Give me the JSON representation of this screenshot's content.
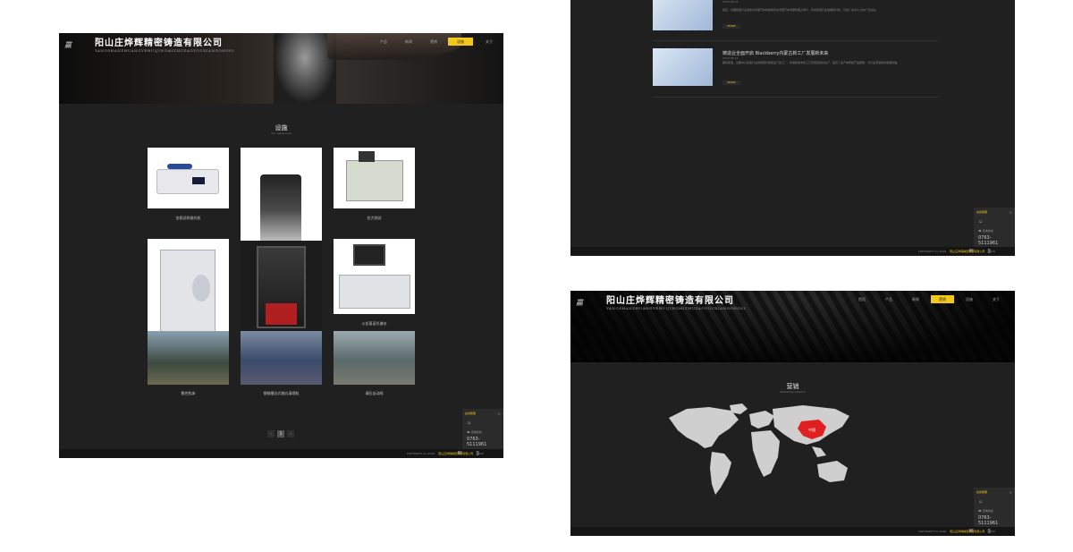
{
  "brand": {
    "name_cn": "阳山庄烨辉精密铸造有限公司",
    "name_en": "YANGSHANZHUANGYEHUIJINGMIZHUZAOYOUXIANGONGSI"
  },
  "screen1": {
    "nav": [
      "产品",
      "新闻",
      "营销",
      "设施",
      "关于"
    ],
    "section_title": "设施",
    "section_subtitle": "Our equipment",
    "items": [
      "金相试样抛光机",
      "拉力测试",
      "火花直读光谱仪",
      "数控机床",
      "钢铁磨边式抛丸清理机",
      "调压自动线"
    ],
    "pager": [
      "‹",
      "1",
      "2",
      "›"
    ]
  },
  "screen2": {
    "news": [
      {
        "title": "",
        "date": "2018-08-12",
        "text": "最近，中国铸造行业协会与中国汽车协会携手在中国汽车零部件展上举行，有关铸造行业发展的讨论，引发了业内人士的广泛关注。",
        "more": "MORE"
      },
      {
        "title": "铸造业全面开启 Blackberry内蒙古新工厂发展新未来",
        "date": "2018-08-12",
        "text": "黑莓铸造，近期中心铸造行业的转型升级建设了新工厂，利用新技术新工艺实现自动化生产，提高了生产效率和产品质量，为行业带来新的发展机遇。",
        "more": "MORE"
      }
    ]
  },
  "screen3": {
    "nav": [
      "首页",
      "产品",
      "新闻",
      "营销",
      "设施",
      "关于"
    ],
    "section_title": "营销",
    "section_subtitle": "Marketing network",
    "china_label": "中国"
  },
  "sidebar": {
    "title": "在线客服",
    "close": "×",
    "phone_label": "咨询热线",
    "phone": "0763-5111961"
  },
  "footer": {
    "copyright": "COPYRIGHT (C) 2018",
    "company": "阳山庄烨辉精密铸造有限公司",
    "suffix": "粤ICP"
  },
  "colors": {
    "accent": "#f2c81a",
    "bg": "#202020",
    "china": "#e02020"
  }
}
